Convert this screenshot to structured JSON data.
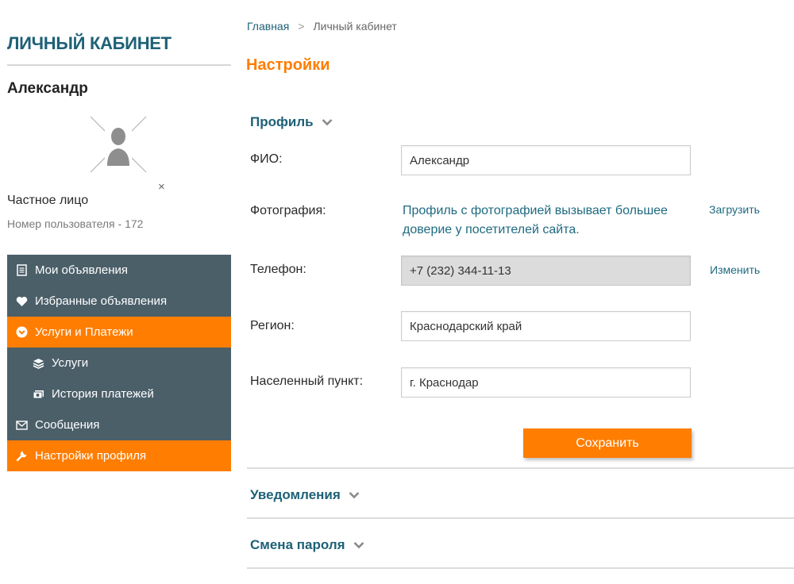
{
  "sidebar": {
    "title": "ЛИЧНЫЙ КАБИНЕТ",
    "user_name": "Александр",
    "avatar_icon": "avatar-placeholder-icon",
    "remove_glyph": "×",
    "user_type": "Частное лицо",
    "user_id": "Номер пользователя - 172",
    "menu": [
      {
        "label": "Мои объявления",
        "icon": "document-icon",
        "active": false,
        "sub": false
      },
      {
        "label": "Избранные объявления",
        "icon": "heart-icon",
        "active": false,
        "sub": false
      },
      {
        "label": "Услуги и Платежи",
        "icon": "chevron-circle-icon",
        "active": true,
        "sub": false
      },
      {
        "label": "Услуги",
        "icon": "layers-icon",
        "active": false,
        "sub": true
      },
      {
        "label": "История платежей",
        "icon": "money-icon",
        "active": false,
        "sub": true
      },
      {
        "label": "Сообщения",
        "icon": "envelope-icon",
        "active": false,
        "sub": false
      },
      {
        "label": "Настройки профиля",
        "icon": "wrench-icon",
        "active": true,
        "sub": false
      }
    ]
  },
  "breadcrumb": {
    "home": "Главная",
    "separator": ">",
    "current": "Личный кабинет"
  },
  "page_title": "Настройки",
  "sections": {
    "profile": "Профиль",
    "notifications": "Уведомления",
    "password": "Смена пароля"
  },
  "profile": {
    "fio_label": "ФИО:",
    "fio_value": "Александр",
    "photo_label": "Фотография:",
    "photo_note": "Профиль с фотографией вызывает большее доверие у посетителей сайта.",
    "photo_upload": "Загрузить",
    "phone_label": "Телефон:",
    "phone_value": "+7 (232) 344-11-13",
    "phone_change": "Изменить",
    "region_label": "Регион:",
    "region_value": "Краснодарский край",
    "city_label": "Населенный пункт:",
    "city_value": "г. Краснодар",
    "save_label": "Сохранить"
  },
  "colors": {
    "accent": "#ff7d00",
    "brand": "#1e6177",
    "menu_bg": "#4b5f69"
  }
}
